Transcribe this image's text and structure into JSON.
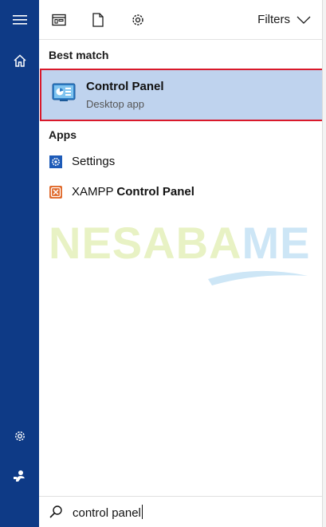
{
  "sidebar": {
    "items": [
      {
        "icon": "hamburger-menu-icon"
      },
      {
        "icon": "home-icon"
      },
      {
        "icon": "gear-icon"
      },
      {
        "icon": "user-feedback-icon"
      }
    ],
    "color": "#0e3a86"
  },
  "topbar": {
    "icons": [
      "apps-filter-icon",
      "documents-filter-icon",
      "settings-filter-icon"
    ],
    "filters_label": "Filters"
  },
  "best_match": {
    "heading": "Best match",
    "title": "Control Panel",
    "subtitle": "Desktop app",
    "highlight_color": "#bfd3ee",
    "border_color": "#d9192b"
  },
  "apps": {
    "heading": "Apps",
    "items": [
      {
        "label": "Settings",
        "icon": "settings-gear-icon",
        "color": "#1e5bb8"
      },
      {
        "label_prefix": "XAMPP ",
        "label_bold": "Control Panel",
        "icon": "xampp-icon",
        "color": "#e06a2c"
      }
    ]
  },
  "watermark": {
    "part1": "NESABA",
    "part2": "MEDIA",
    "color1": "#e8f2c4",
    "color2": "#cde6f6"
  },
  "search": {
    "value": "control panel"
  }
}
